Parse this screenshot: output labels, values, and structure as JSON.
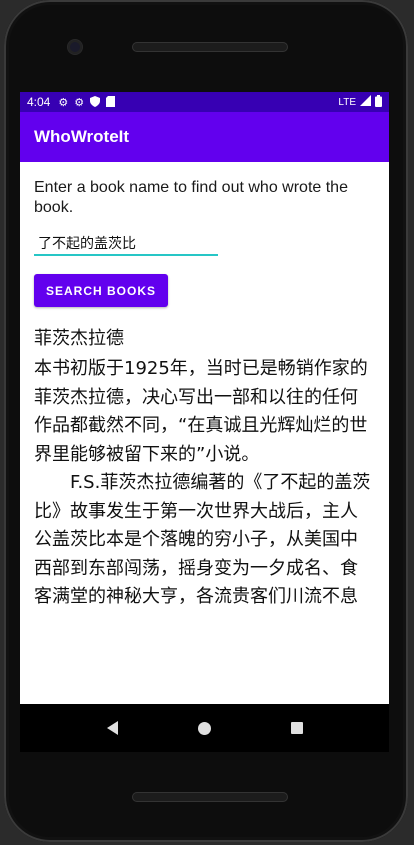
{
  "status_bar": {
    "time": "4:04",
    "network": "LTE",
    "left_icons": [
      "gear-icon",
      "gear-icon",
      "shield-icon",
      "sd-card-icon"
    ],
    "right_icons": [
      "signal-icon",
      "battery-icon"
    ],
    "color": "#3700b3"
  },
  "app_bar": {
    "title": "WhoWroteIt",
    "color": "#6200ee"
  },
  "main": {
    "prompt": "Enter a book name to find out who wrote the book.",
    "search_input_value": "了不起的盖茨比",
    "search_button_label": "SEARCH BOOKS",
    "author": "菲茨杰拉德",
    "description_paragraph_1": "本书初版于1925年，当时已是畅销作家的菲茨杰拉德，决心写出一部和以往的任何作品都截然不同，“在真诚且光辉灿烂的世界里能够被留下来的”小说。",
    "description_paragraph_2": "F.S.菲茨杰拉德编著的《了不起的盖茨比》故事发生于第一次世界大战后，主人公盖茨比本是个落魄的穷小子，从美国中西部到东部闯荡，摇身变为一夕成名、食客满堂的神秘大亨，各流贵客们川流不息"
  },
  "colors": {
    "accent": "#6200ee",
    "input_underline": "#26c6c6"
  },
  "nav_bar": {
    "buttons": [
      "back-icon",
      "home-icon",
      "recents-icon"
    ]
  }
}
